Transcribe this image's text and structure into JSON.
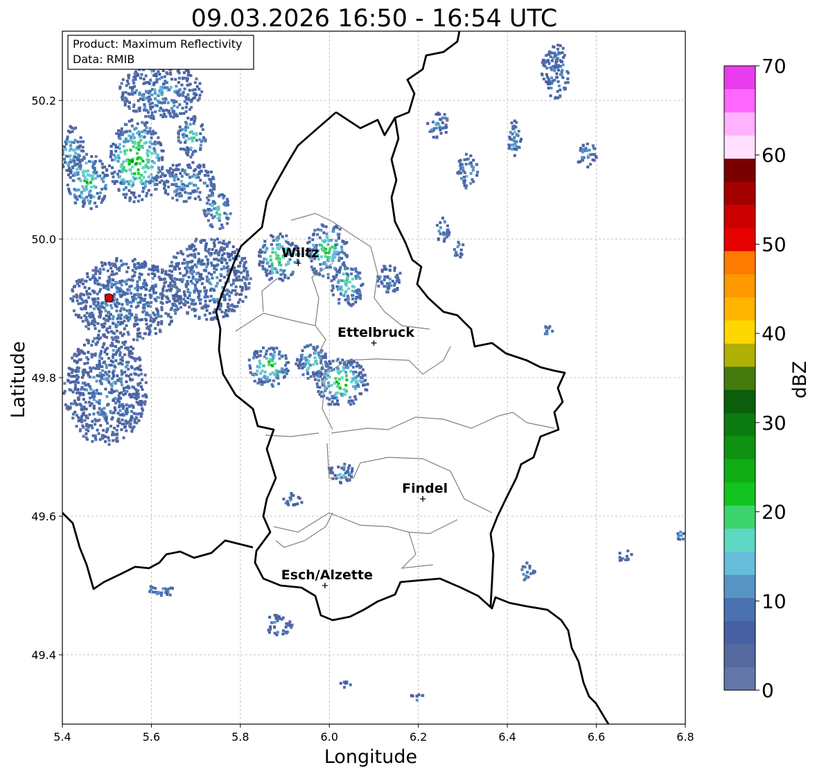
{
  "title": "09.03.2026 16:50 - 16:54 UTC",
  "info_box": {
    "product": "Product: Maximum Reflectivity",
    "data": "Data: RMIB"
  },
  "axes": {
    "xlabel": "Longitude",
    "ylabel": "Latitude",
    "xlim": [
      5.4,
      6.8
    ],
    "ylim": [
      49.3,
      50.3
    ],
    "xticks": [
      "5.4",
      "5.6",
      "5.8",
      "6.0",
      "6.2",
      "6.4",
      "6.6",
      "6.8"
    ],
    "yticks": [
      "49.4",
      "49.6",
      "49.8",
      "50.0",
      "50.2"
    ],
    "grid": true
  },
  "colorbar": {
    "label": "dBZ",
    "range": [
      0,
      70
    ],
    "ticks": [
      "0",
      "10",
      "20",
      "30",
      "40",
      "50",
      "60",
      "70"
    ],
    "colors": [
      "#6476a8",
      "#56699f",
      "#4860a4",
      "#4a72b0",
      "#5694c4",
      "#66bedb",
      "#5ed7c3",
      "#3dd46e",
      "#12c41d",
      "#10ad16",
      "#0e9212",
      "#0b7a10",
      "#0a5e0c",
      "#447a0e",
      "#b0b005",
      "#ffd700",
      "#ffb400",
      "#ff9900",
      "#ff7a00",
      "#e60000",
      "#cc0000",
      "#a30000",
      "#7a0000",
      "#ffe0ff",
      "#ffb3ff",
      "#ff66ff",
      "#e93ded"
    ]
  },
  "cities": [
    {
      "name": "Wiltz",
      "lon": 5.93,
      "lat": 49.965
    },
    {
      "name": "Ettelbruck",
      "lon": 6.1,
      "lat": 49.85
    },
    {
      "name": "Findel",
      "lon": 6.21,
      "lat": 49.625
    },
    {
      "name": "Esch/Alzette",
      "lon": 5.99,
      "lat": 49.5
    }
  ],
  "radar_site": {
    "lon": 5.505,
    "lat": 49.915,
    "color": "#e00000"
  }
}
